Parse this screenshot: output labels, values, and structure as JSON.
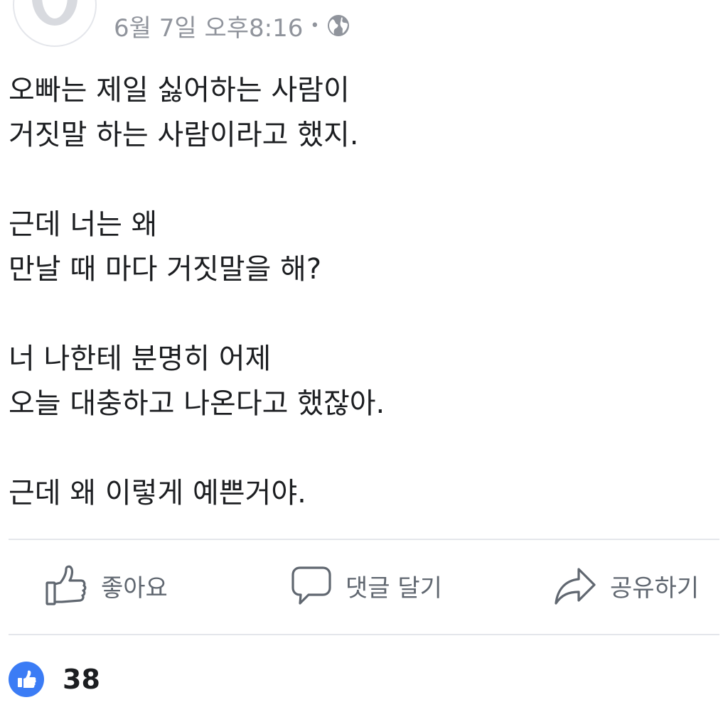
{
  "header": {
    "timestamp": "6월 7일 오후8:16",
    "separator": "•",
    "privacy_icon": "globe-icon"
  },
  "post": {
    "paragraphs": [
      [
        "오빠는 제일 싫어하는 사람이",
        "거짓말 하는 사람이라고 했지."
      ],
      [
        "근데 너는 왜",
        "만날 때 마다 거짓말을 해?"
      ],
      [
        "너 나한테 분명히 어제",
        "오늘 대충하고 나온다고 했잖아."
      ],
      [
        "근데 왜 이렇게 예쁜거야."
      ]
    ]
  },
  "actions": {
    "like": {
      "label": "좋아요",
      "icon": "thumbs-up-icon"
    },
    "comment": {
      "label": "댓글 달기",
      "icon": "speech-bubble-icon"
    },
    "share": {
      "label": "공유하기",
      "icon": "share-arrow-icon"
    }
  },
  "reactions": {
    "icon": "like-reaction-icon",
    "count": "38"
  },
  "colors": {
    "text": "#1c1e21",
    "meta": "#90949c",
    "action": "#606770",
    "like_blue": "#3b7cf5",
    "divider": "#e4e6eb"
  }
}
